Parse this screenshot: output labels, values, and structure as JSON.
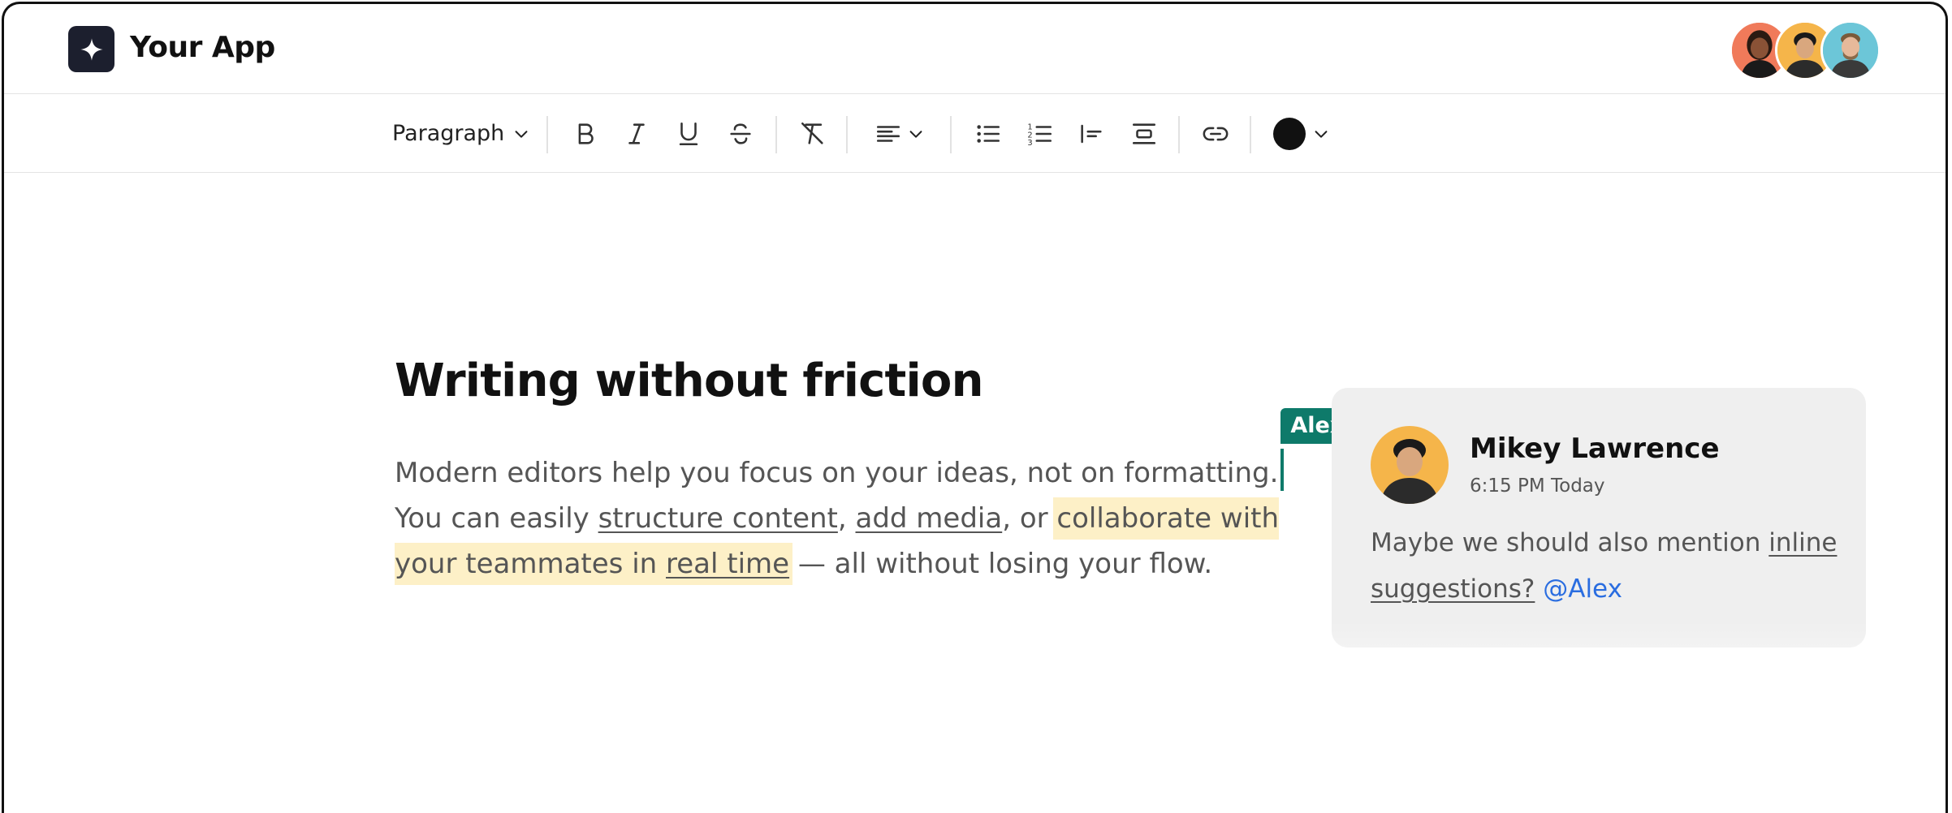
{
  "app": {
    "name": "Your App"
  },
  "collaborators": [
    {
      "name": "collaborator-1",
      "bg": "#f07a5a"
    },
    {
      "name": "collaborator-2",
      "bg": "#f5b54a"
    },
    {
      "name": "collaborator-3",
      "bg": "#6cc6d8"
    }
  ],
  "toolbar": {
    "block_type": "Paragraph",
    "text_color": "#111111",
    "icons": [
      "bold-icon",
      "italic-icon",
      "underline-icon",
      "strikethrough-icon",
      "clear-format-icon",
      "align-left-icon",
      "bullet-list-icon",
      "numbered-list-icon",
      "blockquote-icon",
      "horizontal-rule-icon",
      "link-icon"
    ]
  },
  "document": {
    "title": "Writing without friction",
    "p1": "Modern editors help you focus on your ideas, not on formatting.",
    "p2_a": "You can easily ",
    "link_structure": "structure content",
    "p2_comma": ", ",
    "link_media": "add media",
    "p2_or": ", or ",
    "hl_a": "collaborate with your teammates in ",
    "link_realtime": "real time",
    "p2_end": " — all without losing your flow.",
    "cursor_label": "Alex"
  },
  "comment": {
    "author": "Mikey Lawrence",
    "time": "6:15 PM Today",
    "text_a": "Maybe we should also mention ",
    "link": "inline suggestions?",
    "mention": "@Alex"
  },
  "colors": {
    "accent": "#0e7a6a",
    "highlight": "#fdf0c7",
    "mention": "#2a6de0"
  }
}
